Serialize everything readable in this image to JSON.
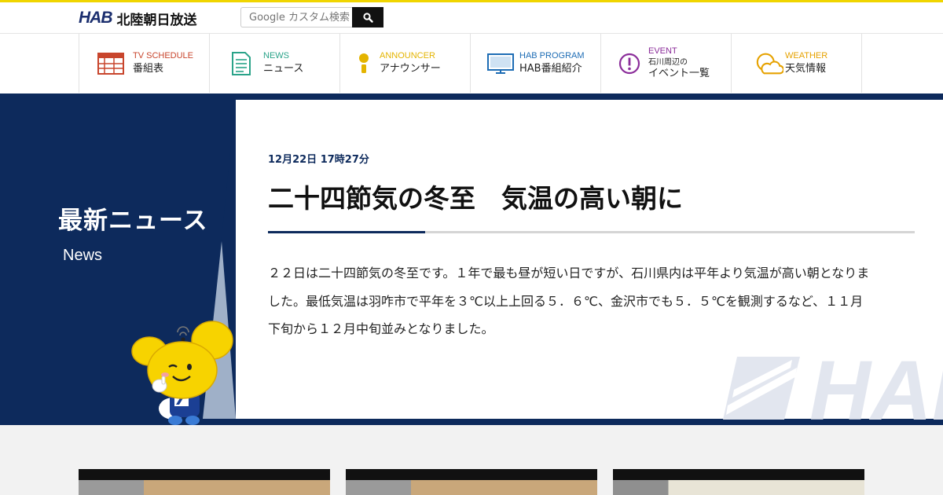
{
  "header": {
    "logo_mark": "HAB",
    "logo_name": "北陸朝日放送",
    "search_placeholder": "Google カスタム検索"
  },
  "nav": {
    "items": [
      {
        "en": "TV SCHEDULE",
        "ja": "番組表",
        "color": "#c8452c",
        "icon": "schedule-grid-icon"
      },
      {
        "en": "NEWS",
        "ja": "ニュース",
        "color": "#2aa389",
        "icon": "news-document-icon"
      },
      {
        "en": "ANNOUNCER",
        "ja": "アナウンサー",
        "color": "#e4b400",
        "icon": "microphone-person-icon"
      },
      {
        "en": "HAB PROGRAM",
        "ja": "HAB番組紹介",
        "color": "#1e6db5",
        "icon": "tv-monitor-icon"
      },
      {
        "en": "EVENT",
        "sub": "石川周辺の",
        "ja": "イベント一覧",
        "color": "#8b2d9a",
        "icon": "exclamation-circle-icon"
      },
      {
        "en": "WEATHER",
        "ja": "天気情報",
        "color": "#e6a200",
        "icon": "sun-cloud-icon"
      }
    ]
  },
  "hero": {
    "title": "最新ニュース",
    "subtitle": "News"
  },
  "article": {
    "date": "12月22日 17時27分",
    "title": "二十四節気の冬至　気温の高い朝に",
    "body": "２２日は二十四節気の冬至です。１年で最も昼が短い日ですが、石川県内は平年より気温が高い朝となりました。最低気温は羽咋市で平年を３℃以上上回る５．６℃、金沢市でも５．５℃を観測するなど、１１月下旬から１２月中旬並みとなりました。"
  },
  "watermark": "HAB"
}
